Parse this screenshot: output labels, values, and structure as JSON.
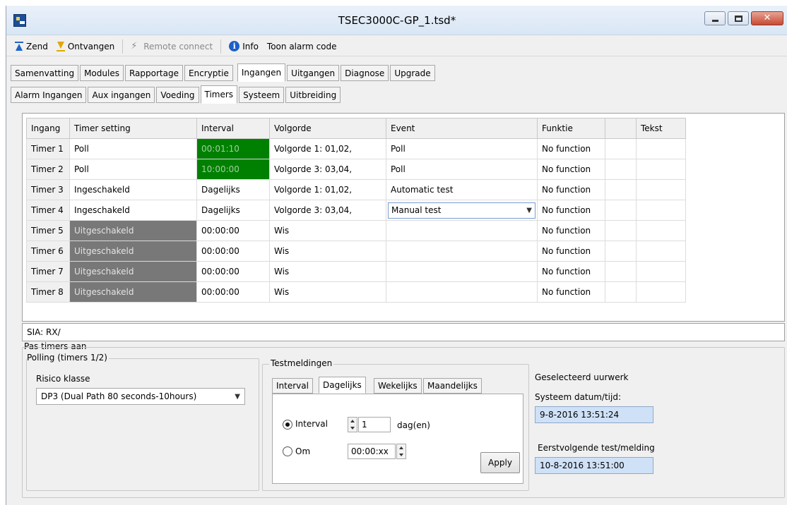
{
  "window": {
    "title": "TSEC3000C-GP_1.tsd*",
    "close_glyph": "✕"
  },
  "toolbar": {
    "send": "Zend",
    "receive": "Ontvangen",
    "remote_connect": "Remote connect",
    "info": "Info",
    "show_alarm_code": "Toon alarm code"
  },
  "main_tabs": [
    "Samenvatting",
    "Modules",
    "Rapportage",
    "Encryptie",
    "Ingangen",
    "Uitgangen",
    "Diagnose",
    "Upgrade"
  ],
  "main_tab_active": "Ingangen",
  "sub_tabs": [
    "Alarm Ingangen",
    "Aux ingangen",
    "Voeding",
    "Timers",
    "Systeem",
    "Uitbreiding"
  ],
  "sub_tab_active": "Timers",
  "grid": {
    "headers": [
      "Ingang",
      "Timer setting",
      "Interval",
      "Volgorde",
      "Event",
      "Funktie",
      "",
      "Tekst"
    ],
    "rows": [
      {
        "ingang": "Timer 1",
        "setting": "Poll",
        "interval": "00:01:10",
        "volgorde": "Volgorde 1: 01,02,",
        "event": "Poll",
        "funktie": "No function",
        "extra": "",
        "tekst": ""
      },
      {
        "ingang": "Timer 2",
        "setting": "Poll",
        "interval": "10:00:00",
        "volgorde": "Volgorde 3: 03,04,",
        "event": "Poll",
        "funktie": "No function",
        "extra": "",
        "tekst": ""
      },
      {
        "ingang": "Timer 3",
        "setting": "Ingeschakeld",
        "interval": "Dagelijks",
        "volgorde": "Volgorde 1: 01,02,",
        "event": "Automatic test",
        "funktie": "No function",
        "extra": "",
        "tekst": ""
      },
      {
        "ingang": "Timer 4",
        "setting": "Ingeschakeld",
        "interval": "Dagelijks",
        "volgorde": "Volgorde 3: 03,04,",
        "event": "Manual test",
        "funktie": "No function",
        "extra": "",
        "tekst": ""
      },
      {
        "ingang": "Timer 5",
        "setting": "Uitgeschakeld",
        "interval": "00:00:00",
        "volgorde": "Wis",
        "event": "",
        "funktie": "No function",
        "extra": "",
        "tekst": ""
      },
      {
        "ingang": "Timer 6",
        "setting": "Uitgeschakeld",
        "interval": "00:00:00",
        "volgorde": "Wis",
        "event": "",
        "funktie": "No function",
        "extra": "",
        "tekst": ""
      },
      {
        "ingang": "Timer 7",
        "setting": "Uitgeschakeld",
        "interval": "00:00:00",
        "volgorde": "Wis",
        "event": "",
        "funktie": "No function",
        "extra": "",
        "tekst": ""
      },
      {
        "ingang": "Timer 8",
        "setting": "Uitgeschakeld",
        "interval": "00:00:00",
        "volgorde": "Wis",
        "event": "",
        "funktie": "No function",
        "extra": "",
        "tekst": ""
      }
    ]
  },
  "sia": "SIA: RX/",
  "adjust": {
    "title": "Pas timers aan",
    "polling": {
      "title": "Polling (timers 1/2)",
      "risk_label": "Risico klasse",
      "risk_value": "DP3 (Dual Path 80 seconds-10hours)"
    },
    "test": {
      "title": "Testmeldingen",
      "tabs": [
        "Interval",
        "Dagelijks",
        "Wekelijks",
        "Maandelijks"
      ],
      "active_tab": "Dagelijks",
      "interval_label": "Interval",
      "interval_value": "1",
      "interval_unit": "dag(en)",
      "at_label": "Om",
      "at_value": "00:00:xx",
      "apply": "Apply"
    },
    "clock": {
      "title": "Geselecteerd uurwerk",
      "system_label": "Systeem datum/tijd:",
      "system_value": "9-8-2016 13:51:24",
      "next_label": "Eerstvolgende test/melding",
      "next_value": "10-8-2016 13:51:00"
    }
  },
  "colors": {
    "interval_highlight": "#008000",
    "disabled_cell": "#787878",
    "readout_bg": "#cfe1f7"
  }
}
